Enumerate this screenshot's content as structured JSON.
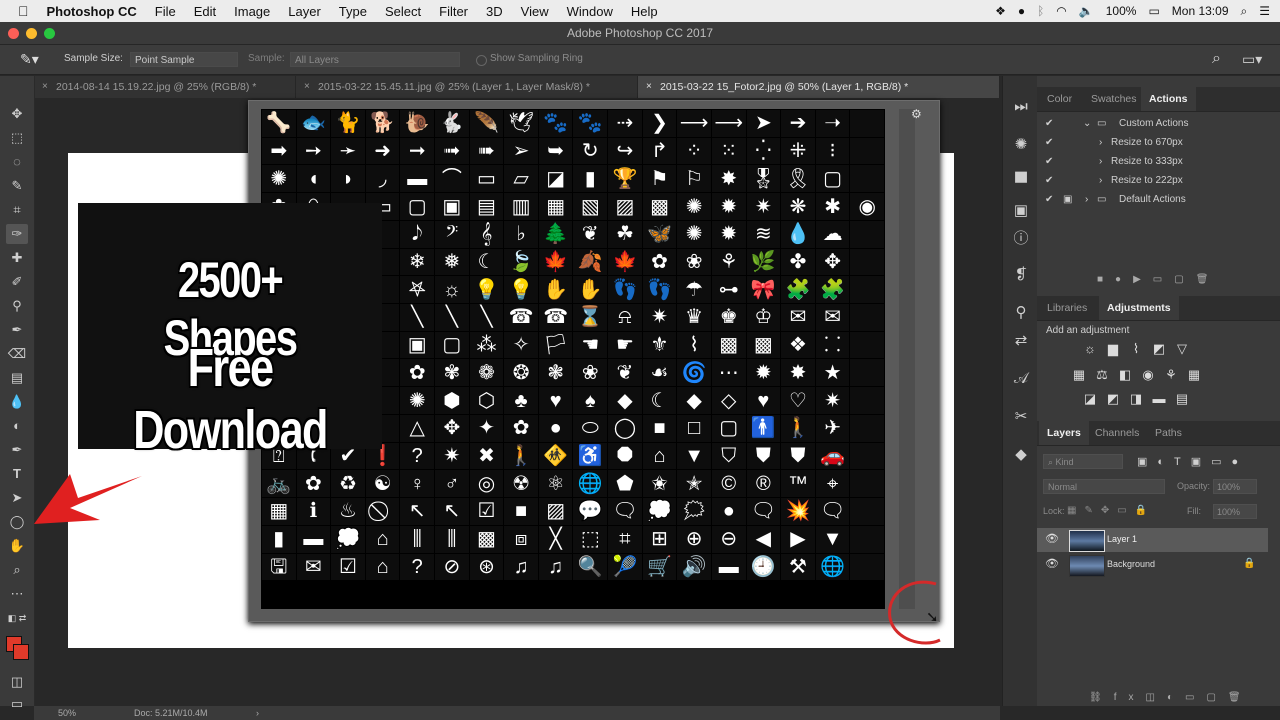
{
  "menubar": {
    "apple": "",
    "app": "Photoshop CC",
    "items": [
      "File",
      "Edit",
      "Image",
      "Layer",
      "Type",
      "Select",
      "Filter",
      "3D",
      "View",
      "Window",
      "Help"
    ],
    "battery": "100%",
    "clock": "Mon 13:09"
  },
  "window_title": "Adobe Photoshop CC 2017",
  "options": {
    "sample_size_label": "Sample Size:",
    "sample_size_value": "Point Sample",
    "sample_label": "Sample:",
    "sample_value": "All Layers",
    "sampling_ring": "Show Sampling Ring"
  },
  "tabs": [
    {
      "label": "2014-08-14 15.19.22.jpg @ 25% (RGB/8) *",
      "close": "×"
    },
    {
      "label": "2015-03-22 15.45.11.jpg @ 25% (Layer 1, Layer Mask/8) *",
      "close": "×"
    },
    {
      "label": "2015-03-22 15_Fotor2.jpg @ 50% (Layer 1, RGB/8) *",
      "close": "×"
    }
  ],
  "overlay": {
    "line1": "2500+ Shapes",
    "line2": "Free Download"
  },
  "actions_panel": {
    "tabs": [
      "Color",
      "Swatches",
      "Actions"
    ],
    "items": [
      {
        "label": "Custom Actions",
        "check": "✔",
        "expander": "⌄"
      },
      {
        "label": "Resize to 670px",
        "check": "✔",
        "expander": "›"
      },
      {
        "label": "Resize to 333px",
        "check": "✔",
        "expander": "›"
      },
      {
        "label": "Resize to 222px",
        "check": "✔",
        "expander": "›"
      },
      {
        "label": "Default Actions",
        "check": "✔",
        "expander": "›"
      }
    ]
  },
  "adjustments_panel": {
    "tabs": [
      "Libraries",
      "Adjustments"
    ],
    "heading": "Add an adjustment"
  },
  "layers_panel": {
    "tabs": [
      "Layers",
      "Channels",
      "Paths"
    ],
    "filter": "Kind",
    "blend_mode": "Normal",
    "opacity_label": "Opacity:",
    "opacity_value": "100%",
    "lock_label": "Lock:",
    "fill_label": "Fill:",
    "fill_value": "100%",
    "layers": [
      {
        "name": "Layer 1",
        "selected": true
      },
      {
        "name": "Background",
        "selected": false
      }
    ]
  },
  "status": {
    "zoom": "50%",
    "doc": "Doc: 5.21M/10.4M",
    "arrow": "›"
  },
  "shape_glyphs": [
    "🦴",
    "🐟",
    "🐈",
    "🐕",
    "🐌",
    "🐇",
    "🪶",
    "🕊",
    "🐾",
    "🐾",
    "⇢",
    "❯",
    "⟶",
    "⟶",
    "➤",
    "➔",
    "➝",
    "",
    "➡",
    "➙",
    "➛",
    "➜",
    "➞",
    "➟",
    "➠",
    "➢",
    "➥",
    "↻",
    "↪",
    "↱",
    "⁘",
    "⁙",
    "⁛",
    "⁜",
    "⁝",
    "",
    "✺",
    "◖",
    "◗",
    "◞",
    "▬",
    "⌒",
    "▭",
    "▱",
    "◪",
    "▮",
    "🏆",
    "⚑",
    "⚐",
    "✸",
    "🎖",
    "🎗",
    "▢",
    "",
    "✿",
    "⬯",
    "",
    "▭",
    "▢",
    "▣",
    "▤",
    "▥",
    "▦",
    "▧",
    "▨",
    "▩",
    "✺",
    "✹",
    "✷",
    "❋",
    "✱",
    "◉",
    "",
    "",
    "",
    "",
    "𝅘𝅥𝅮",
    "𝄢",
    "𝄞",
    "♭",
    "🌲",
    "❦",
    "☘",
    "🦋",
    "✺",
    "✹",
    "≋",
    "💧",
    "☁",
    "",
    "",
    "",
    "",
    "",
    "❄",
    "❅",
    "☾",
    "🍃",
    "🍁",
    "🍂",
    "🍁",
    "✿",
    "❀",
    "⚘",
    "🌿",
    "✤",
    "✥",
    "",
    "",
    "",
    "",
    "",
    "𖤐",
    "☼",
    "💡",
    "💡",
    "✋",
    "✋",
    "👣",
    "👣",
    "☂",
    "⊶",
    "🎀",
    "🧩",
    "🧩",
    "",
    "",
    "",
    "",
    "",
    "╲",
    "╲",
    "╲",
    "☎",
    "☎",
    "⌛",
    "⍾",
    "✷",
    "♛",
    "♚",
    "♔",
    "✉",
    "✉",
    "",
    "",
    "",
    "",
    "",
    "▣",
    "▢",
    "⁂",
    "✧",
    "🏳",
    "☚",
    "☛",
    "⚜",
    "⌇",
    "▩",
    "▩",
    "❖",
    "⸬",
    "",
    "",
    "",
    "",
    "",
    "✿",
    "✾",
    "❁",
    "❂",
    "❃",
    "❀",
    "❦",
    "☙",
    "🌀",
    "⋯",
    "✹",
    "✸",
    "★",
    "",
    "",
    "",
    "",
    "",
    "✺",
    "⬢",
    "⬡",
    "♣",
    "♥",
    "♠",
    "◆",
    "☾",
    "◆",
    "◇",
    "♥",
    "♡",
    "✷",
    "",
    "",
    "",
    "",
    "",
    "△",
    "✥",
    "✦",
    "✿",
    "●",
    "⬭",
    "◯",
    "■",
    "□",
    "▢",
    "🚹",
    "🚶",
    "✈",
    "",
    "⍰",
    "🕻",
    "✔",
    "❗",
    "?",
    "✷",
    "✖",
    "🚶",
    "🚸",
    "♿",
    "⯃",
    "⌂",
    "▼",
    "⛉",
    "⛊",
    "⛊",
    "🚗",
    "",
    "🚲",
    "✿",
    "♻",
    "☯",
    "♀",
    "♂",
    "◎",
    "☢",
    "⚛",
    "🌐",
    "⬟",
    "✬",
    "✭",
    "©",
    "®",
    "™",
    "⌖",
    "",
    "▦",
    "ℹ",
    "♨",
    "⃠",
    "↖",
    "↖",
    "☑",
    "■",
    "▨",
    "💬",
    "🗨",
    "💭",
    "🗯",
    "●",
    "🗨",
    "💥",
    "🗨",
    "",
    "▮",
    "▬",
    "💭",
    "⌂",
    "⫼",
    "⫼",
    "▩",
    "⧈",
    "╳",
    "⬚",
    "⌗",
    "⊞",
    "⊕",
    "⊖",
    "◀",
    "▶",
    "▼",
    "",
    "🖫",
    "✉",
    "☑",
    "⌂",
    "?",
    "⊘",
    "⊛",
    "♫",
    "♫",
    "🔍",
    "🎾",
    "🛒",
    "🔊",
    "▬",
    "🕘",
    "⚒",
    "🌐",
    ""
  ]
}
